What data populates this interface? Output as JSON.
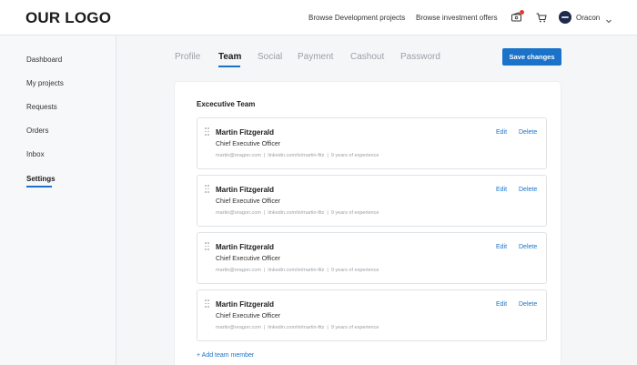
{
  "header": {
    "logo": "OUR LOGO",
    "nav": [
      "Browse Development projects",
      "Browse investment offers"
    ],
    "icons": [
      "cash-icon",
      "cart-icon"
    ],
    "user": {
      "name": "Oracon"
    }
  },
  "sidebar": {
    "items": [
      {
        "label": "Dashboard"
      },
      {
        "label": "My projects"
      },
      {
        "label": "Requests"
      },
      {
        "label": "Orders"
      },
      {
        "label": "Inbox"
      },
      {
        "label": "Settings",
        "active": true
      }
    ]
  },
  "tabs": [
    {
      "label": "Profile"
    },
    {
      "label": "Team",
      "active": true
    },
    {
      "label": "Social"
    },
    {
      "label": "Payment"
    },
    {
      "label": "Cashout"
    },
    {
      "label": "Password"
    }
  ],
  "save_label": "Save changes",
  "team": {
    "title": "Excecutive Team",
    "members": [
      {
        "name": "Martin Fitzgerald",
        "role": "Chief Executive Officer",
        "email": "martin@oragon.com",
        "linkedin": "linkedin.com/in/martin-fitz",
        "experience": "9 years of experience"
      },
      {
        "name": "Martin Fitzgerald",
        "role": "Chief Executive Officer",
        "email": "martin@oragon.com",
        "linkedin": "linkedin.com/in/martin-fitz",
        "experience": "9 years of experience"
      },
      {
        "name": "Martin Fitzgerald",
        "role": "Chief Executive Officer",
        "email": "martin@oragon.com",
        "linkedin": "linkedin.com/in/martin-fitz",
        "experience": "9 years of experience"
      },
      {
        "name": "Martin Fitzgerald",
        "role": "Chief Executive Officer",
        "email": "martin@oragon.com",
        "linkedin": "linkedin.com/in/martin-fitz",
        "experience": "9 years of experience"
      }
    ],
    "edit_label": "Edit",
    "delete_label": "Delete",
    "separator": "|",
    "add_label": "+ Add team member"
  },
  "colors": {
    "accent": "#1a73c9",
    "notification": "#e53935",
    "avatar": "#1d2a4d"
  }
}
